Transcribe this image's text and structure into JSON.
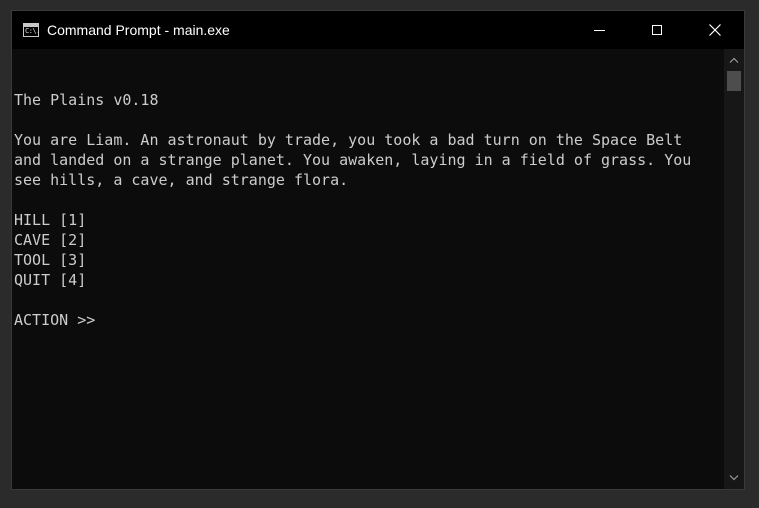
{
  "window": {
    "title": "Command Prompt - main.exe",
    "icon": "cmd-icon",
    "icon_text": "C:\\.",
    "controls": {
      "minimize": "minimize-icon",
      "maximize": "maximize-icon",
      "close": "close-icon"
    }
  },
  "console": {
    "lines": [
      "",
      "The Plains v0.18",
      "",
      "You are Liam. An astronaut by trade, you took a bad turn on the Space Belt",
      "and landed on a strange planet. You awaken, laying in a field of grass. You",
      "see hills, a cave, and strange flora.",
      "",
      "HILL [1]",
      "CAVE [2]",
      "TOOL [3]",
      "QUIT [4]",
      "",
      "ACTION >>"
    ]
  },
  "colors": {
    "titlebar": "#000000",
    "console_bg": "#0c0c0c",
    "console_text": "#cccccc",
    "scrollbar_track": "#171717",
    "scrollbar_thumb": "#4d4d4d"
  }
}
